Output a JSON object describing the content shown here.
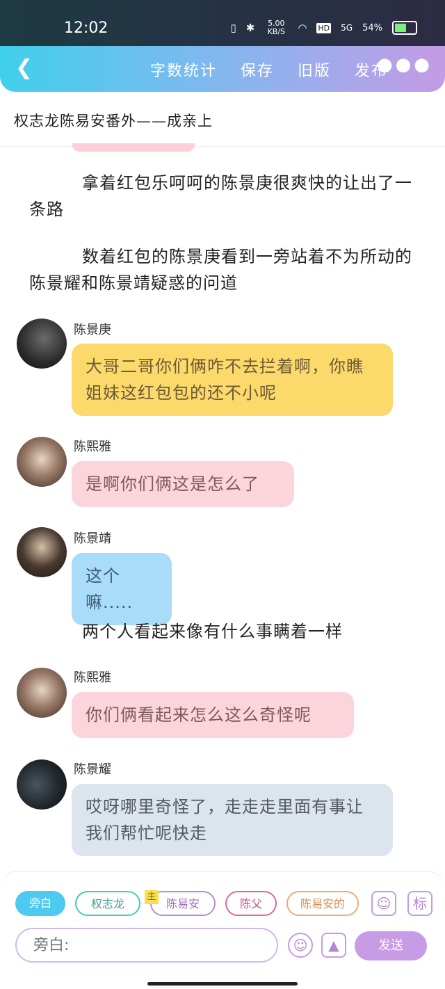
{
  "status_bar": {
    "time": "12:02",
    "network_speed": "5.00 KB/S",
    "hd": "HD",
    "signal": "5G",
    "battery": "54%",
    "battery_level": 0.54
  },
  "toolbar": {
    "back_icon": "chevron-left-icon",
    "menu": [
      "字数统计",
      "保存",
      "旧版",
      "发布"
    ],
    "more_icon": "more-dots-icon"
  },
  "story": {
    "title": "权志龙陈易安番外——成亲上"
  },
  "messages": [
    {
      "type": "narration",
      "text": "拿着红包乐呵呵的陈景庚很爽快的让出了一条路"
    },
    {
      "type": "narration",
      "text": "数着红包的陈景庚看到一旁站着不为所动的陈景耀和陈景靖疑惑的问道"
    },
    {
      "type": "dialog",
      "speaker": "陈景庚",
      "text": "大哥二哥你们俩咋不去拦着啊，你瞧姐妹这红包包的还不小呢",
      "color": "#fbd96a"
    },
    {
      "type": "dialog",
      "speaker": "陈熙雅",
      "text": "是啊你们俩这是怎么了",
      "color": "#fcd4dc"
    },
    {
      "type": "dialog",
      "speaker": "陈景靖",
      "text": "这个嘛.....",
      "color": "#a8dcf8"
    },
    {
      "type": "narration",
      "text": "两个人看起来像有什么事瞒着一样"
    },
    {
      "type": "dialog",
      "speaker": "陈熙雅",
      "text": "你们俩看起来怎么这么奇怪呢",
      "color": "#fcd4dc"
    },
    {
      "type": "dialog",
      "speaker": "陈景耀",
      "text": "哎呀哪里奇怪了，走走走里面有事让我们帮忙呢快走",
      "color": "#dce4ee"
    }
  ],
  "roles": {
    "chips": [
      "旁白",
      "权志龙",
      "陈易安",
      "陈父",
      "陈易安的"
    ],
    "host_badge": "主",
    "active": "旁白",
    "user_icon": "user-card-icon",
    "tag_label": "标"
  },
  "composer": {
    "placeholder": "旁白:",
    "emoji_icon": "emoji-icon",
    "image_icon": "image-icon",
    "send_label": "发送"
  }
}
